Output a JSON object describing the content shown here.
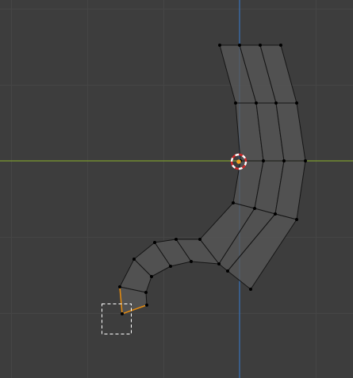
{
  "viewport": {
    "background_color": "#3d3d3d",
    "grid_minor_color": "#454545",
    "grid_major_color": "#4e4e4e",
    "x_axis_color": "#7c9a2f",
    "y_axis_color": "#3a6fb0",
    "mesh_face_color": "#575757",
    "mesh_edge_color": "#151515",
    "mesh_vertex_color": "#000000",
    "selected_edge_color": "#e08a12",
    "box_select_color": "#ffffff",
    "cursor_ring_colors": [
      "#ffffff",
      "#d02828"
    ],
    "origin_color": "#f0a020"
  },
  "icons": {
    "cursor": "3d-cursor-icon",
    "origin": "object-origin-icon"
  }
}
